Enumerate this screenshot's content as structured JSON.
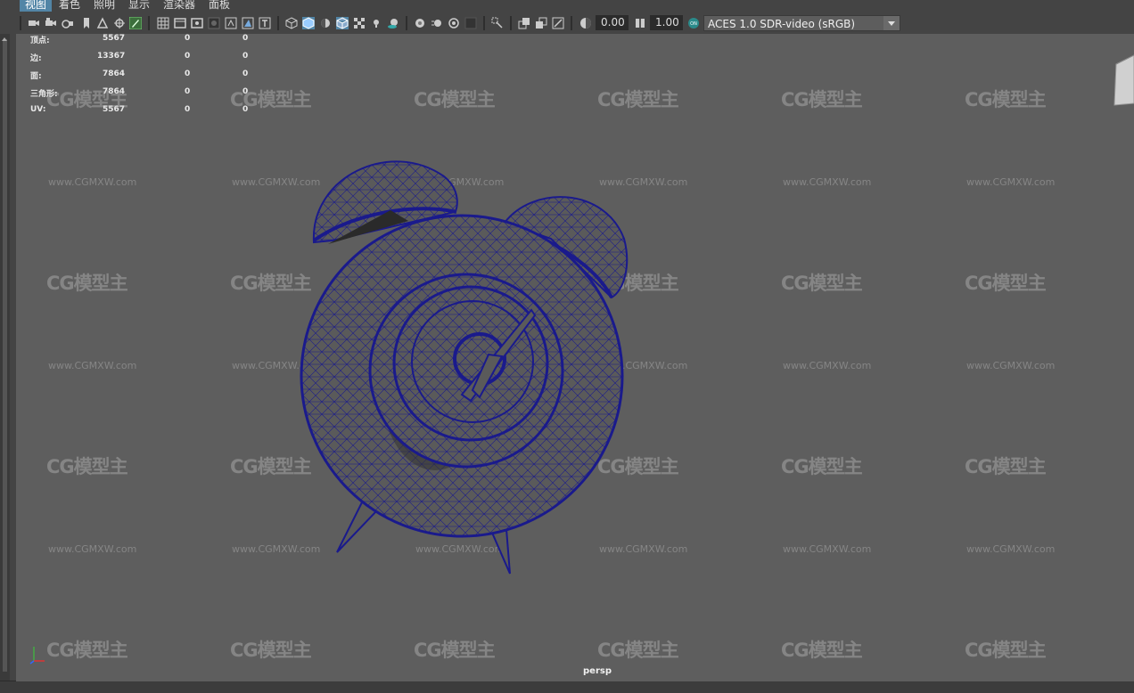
{
  "menus": [
    "视图",
    "着色",
    "照明",
    "显示",
    "渲染器",
    "面板"
  ],
  "toolbar": {
    "exposure": "0.00",
    "gamma": "1.00",
    "colorspace": "ACES 1.0 SDR-video (sRGB)"
  },
  "hud": {
    "rows": [
      {
        "label": "顶点:",
        "v1": "5567",
        "v2": "0",
        "v3": "0"
      },
      {
        "label": "边:",
        "v1": "13367",
        "v2": "0",
        "v3": "0"
      },
      {
        "label": "面:",
        "v1": "7864",
        "v2": "0",
        "v3": "0"
      },
      {
        "label": "三角形:",
        "v1": "7864",
        "v2": "0",
        "v3": "0"
      },
      {
        "label": "UV:",
        "v1": "5567",
        "v2": "0",
        "v3": "0"
      }
    ]
  },
  "camera": "persp",
  "watermark": {
    "logo": "CG模型主",
    "url": "www.CGMXW.com"
  },
  "colors": {
    "viewport_bg": "#5e5e5e",
    "wireframe": "#1a1a8c",
    "model_fill": "#5a5a5a",
    "ui_bg": "#444444",
    "menu_active": "#5285a6"
  }
}
